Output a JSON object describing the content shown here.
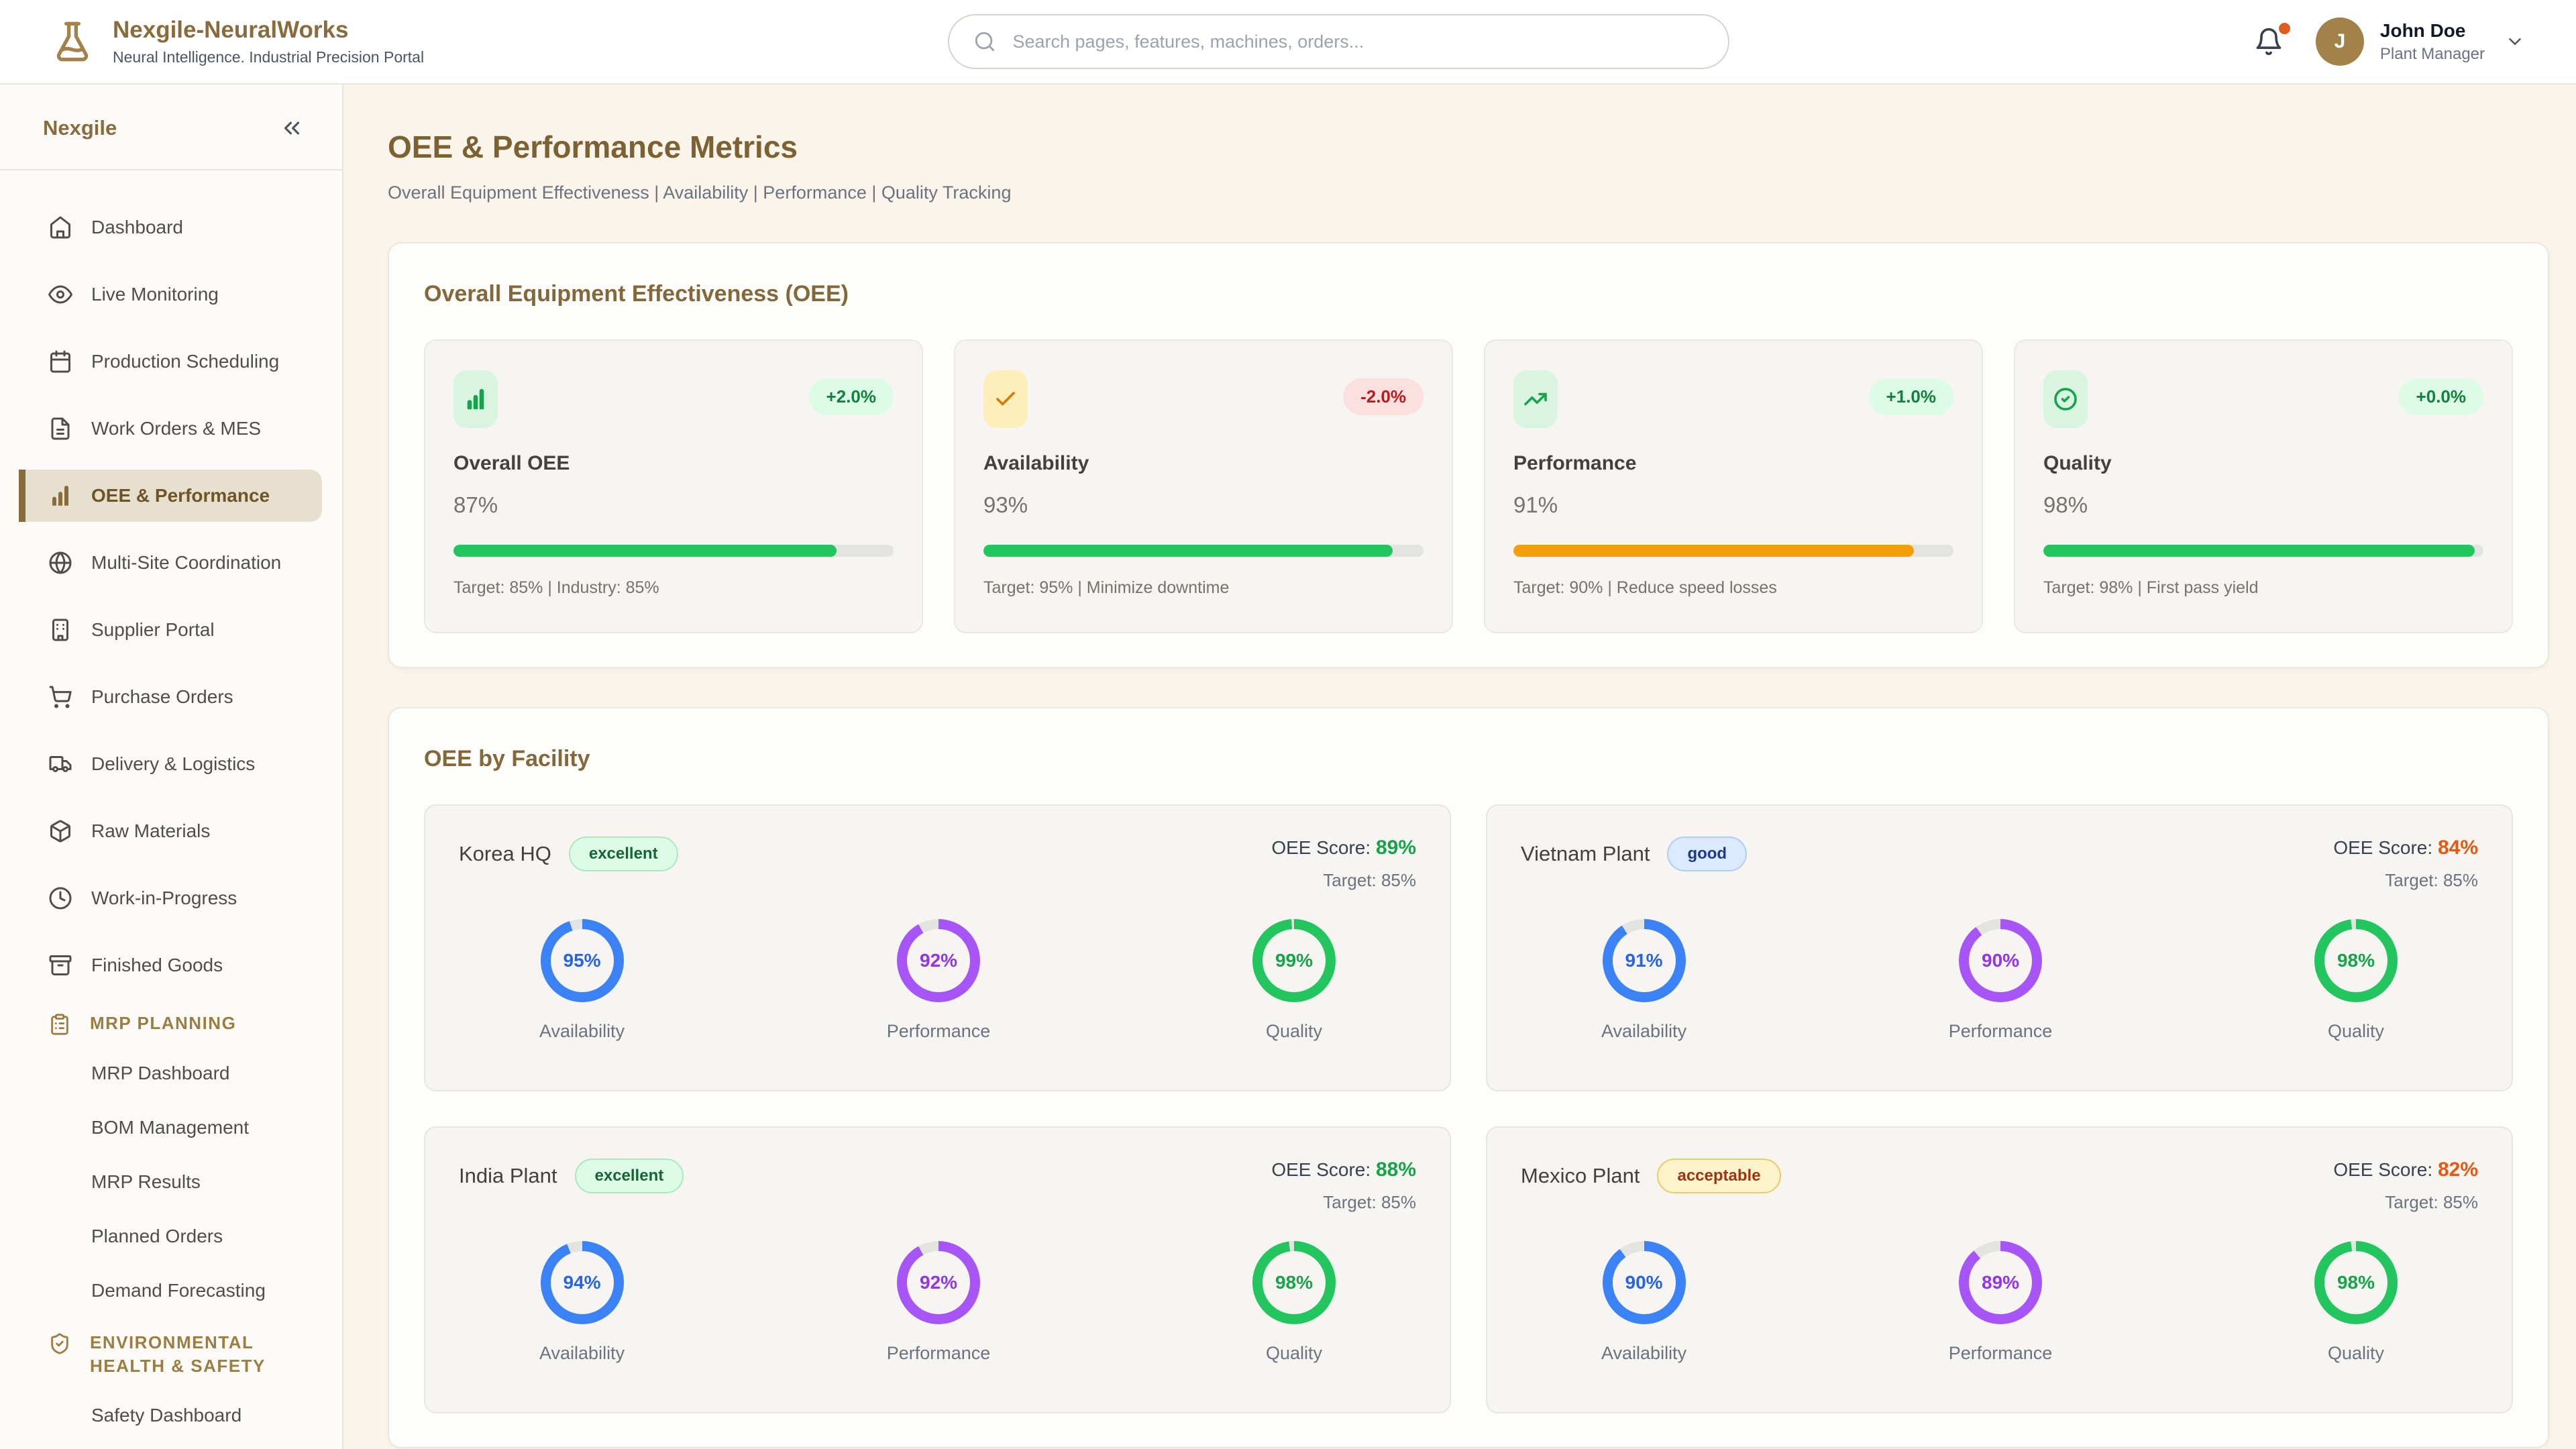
{
  "header": {
    "brand_title": "Nexgile-NeuralWorks",
    "brand_subtitle": "Neural Intelligence. Industrial Precision Portal",
    "search_placeholder": "Search pages, features, machines, orders...",
    "user_initial": "J",
    "user_name": "John Doe",
    "user_role": "Plant Manager",
    "notification_dot_color": "#e25c1d",
    "avatar_color": "#a3824a"
  },
  "sidebar": {
    "title": "Nexgile",
    "collapse_icon": "chevrons-left-icon",
    "items": [
      {
        "label": "Dashboard",
        "icon": "home-icon",
        "active": false
      },
      {
        "label": "Live Monitoring",
        "icon": "eye-icon",
        "active": false
      },
      {
        "label": "Production Scheduling",
        "icon": "calendar-icon",
        "active": false
      },
      {
        "label": "Work Orders & MES",
        "icon": "file-text-icon",
        "active": false
      },
      {
        "label": "OEE & Performance",
        "icon": "bar-chart-icon",
        "active": true
      },
      {
        "label": "Multi-Site Coordination",
        "icon": "globe-icon",
        "active": false
      },
      {
        "label": "Supplier Portal",
        "icon": "building-icon",
        "active": false
      },
      {
        "label": "Purchase Orders",
        "icon": "shopping-cart-icon",
        "active": false
      },
      {
        "label": "Delivery & Logistics",
        "icon": "truck-icon",
        "active": false
      },
      {
        "label": "Raw Materials",
        "icon": "package-icon",
        "active": false
      },
      {
        "label": "Work-in-Progress",
        "icon": "clock-icon",
        "active": false
      },
      {
        "label": "Finished Goods",
        "icon": "archive-icon",
        "active": false
      }
    ],
    "sections": [
      {
        "label": "MRP PLANNING",
        "icon": "clipboard-list-icon",
        "children": [
          "MRP Dashboard",
          "BOM Management",
          "MRP Results",
          "Planned Orders",
          "Demand Forecasting"
        ]
      },
      {
        "label": "ENVIRONMENTAL HEALTH & SAFETY",
        "icon": "shield-check-icon",
        "children": [
          "Safety Dashboard"
        ]
      }
    ]
  },
  "page": {
    "title": "OEE & Performance Metrics",
    "subtitle": "Overall Equipment Effectiveness | Availability | Performance | Quality Tracking"
  },
  "oee_section": {
    "title": "Overall Equipment Effectiveness (OEE)",
    "metrics": [
      {
        "name": "Overall OEE",
        "value": "87%",
        "pct": 87,
        "delta": "+2.0%",
        "delta_color": "#15803d",
        "delta_bg": "#dcfce7",
        "icon": "bar-chart-icon",
        "icon_color": "#16a34a",
        "icon_bg": "#d9f5e2",
        "bar_color": "#22c55e",
        "footer": "Target: 85% | Industry: 85%"
      },
      {
        "name": "Availability",
        "value": "93%",
        "pct": 93,
        "delta": "-2.0%",
        "delta_color": "#b91c1c",
        "delta_bg": "#fce0e0",
        "icon": "check-icon",
        "icon_color": "#d97706",
        "icon_bg": "#fdeeba",
        "bar_color": "#22c55e",
        "footer": "Target: 95% | Minimize downtime"
      },
      {
        "name": "Performance",
        "value": "91%",
        "pct": 91,
        "delta": "+1.0%",
        "delta_color": "#15803d",
        "delta_bg": "#dcfce7",
        "icon": "trending-up-icon",
        "icon_color": "#16a34a",
        "icon_bg": "#d9f5e2",
        "bar_color": "#f59e0b",
        "footer": "Target: 90% | Reduce speed losses"
      },
      {
        "name": "Quality",
        "value": "98%",
        "pct": 98,
        "delta": "+0.0%",
        "delta_color": "#15803d",
        "delta_bg": "#dcfce7",
        "icon": "circle-check-icon",
        "icon_color": "#16a34a",
        "icon_bg": "#d9f5e2",
        "bar_color": "#22c55e",
        "footer": "Target: 98% | First pass yield"
      }
    ]
  },
  "facility_section": {
    "title": "OEE by Facility",
    "score_label": "OEE Score:",
    "facilities": [
      {
        "name": "Korea HQ",
        "badge": "excellent",
        "badge_color": "#166534",
        "badge_bg": "#dcfce7",
        "badge_border": "#abe8bb",
        "score": "89%",
        "score_color": "#16a34a",
        "target": "Target: 85%",
        "rings": [
          {
            "label": "Availability",
            "text": "95%",
            "pct": 95,
            "color": "#3b82f6",
            "text_color": "#2563eb"
          },
          {
            "label": "Performance",
            "text": "92%",
            "pct": 92,
            "color": "#a855f7",
            "text_color": "#9333ea"
          },
          {
            "label": "Quality",
            "text": "99%",
            "pct": 99,
            "color": "#22c55e",
            "text_color": "#16a34a"
          }
        ]
      },
      {
        "name": "Vietnam Plant",
        "badge": "good",
        "badge_color": "#1e3a8a",
        "badge_bg": "#dbeafe",
        "badge_border": "#b0cdf6",
        "score": "84%",
        "score_color": "#ea580c",
        "target": "Target: 85%",
        "rings": [
          {
            "label": "Availability",
            "text": "91%",
            "pct": 91,
            "color": "#3b82f6",
            "text_color": "#2563eb"
          },
          {
            "label": "Performance",
            "text": "90%",
            "pct": 90,
            "color": "#a855f7",
            "text_color": "#9333ea"
          },
          {
            "label": "Quality",
            "text": "98%",
            "pct": 98,
            "color": "#22c55e",
            "text_color": "#16a34a"
          }
        ]
      },
      {
        "name": "India Plant",
        "badge": "excellent",
        "badge_color": "#166534",
        "badge_bg": "#dcfce7",
        "badge_border": "#abe8bb",
        "score": "88%",
        "score_color": "#16a34a",
        "target": "Target: 85%",
        "rings": [
          {
            "label": "Availability",
            "text": "94%",
            "pct": 94,
            "color": "#3b82f6",
            "text_color": "#2563eb"
          },
          {
            "label": "Performance",
            "text": "92%",
            "pct": 92,
            "color": "#a855f7",
            "text_color": "#9333ea"
          },
          {
            "label": "Quality",
            "text": "98%",
            "pct": 98,
            "color": "#22c55e",
            "text_color": "#16a34a"
          }
        ]
      },
      {
        "name": "Mexico Plant",
        "badge": "acceptable",
        "badge_color": "#9a3412",
        "badge_bg": "#fdf3cb",
        "badge_border": "#ecca66",
        "score": "82%",
        "score_color": "#ea580c",
        "target": "Target: 85%",
        "rings": [
          {
            "label": "Availability",
            "text": "90%",
            "pct": 90,
            "color": "#3b82f6",
            "text_color": "#2563eb"
          },
          {
            "label": "Performance",
            "text": "89%",
            "pct": 89,
            "color": "#a855f7",
            "text_color": "#9333ea"
          },
          {
            "label": "Quality",
            "text": "98%",
            "pct": 98,
            "color": "#22c55e",
            "text_color": "#16a34a"
          }
        ]
      }
    ]
  }
}
